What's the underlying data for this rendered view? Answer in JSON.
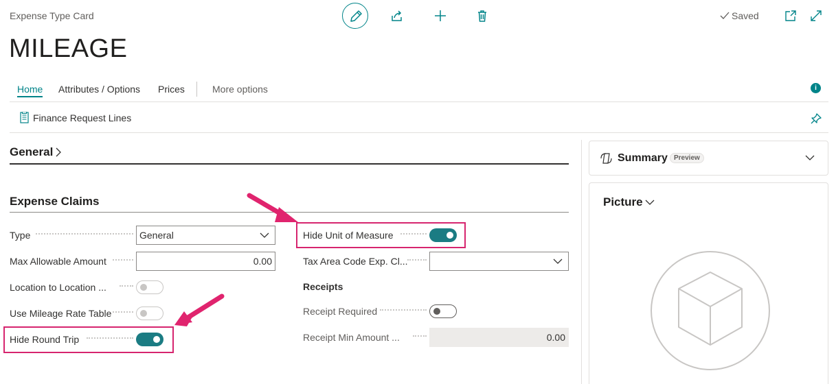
{
  "header": {
    "breadcrumb": "Expense Type Card",
    "title": "MILEAGE",
    "saved_status": "Saved"
  },
  "tabs": [
    {
      "label": "Home",
      "active": true
    },
    {
      "label": "Attributes / Options"
    },
    {
      "label": "Prices"
    },
    {
      "label": "More options"
    }
  ],
  "actions": {
    "finance_request_lines": "Finance Request Lines"
  },
  "sections": {
    "general": "General",
    "expense_claims": "Expense Claims",
    "receipts": "Receipts"
  },
  "fields": {
    "type": {
      "label": "Type",
      "value": "General"
    },
    "max_allowable_amount": {
      "label": "Max Allowable Amount",
      "value": "0.00"
    },
    "location_to_location": {
      "label": "Location to Location ..."
    },
    "use_mileage_rate_table": {
      "label": "Use Mileage Rate Table"
    },
    "hide_round_trip": {
      "label": "Hide Round Trip"
    },
    "hide_unit_of_measure": {
      "label": "Hide Unit of Measure"
    },
    "tax_area_code": {
      "label": "Tax Area Code Exp. Cl...",
      "value": ""
    },
    "receipt_required": {
      "label": "Receipt Required"
    },
    "receipt_min_amount": {
      "label": "Receipt Min Amount ...",
      "value": "0.00"
    }
  },
  "factbox": {
    "summary": "Summary",
    "preview_badge": "Preview",
    "picture": "Picture"
  },
  "colors": {
    "accent": "#008489",
    "toggle_on": "#1b7c83",
    "highlight": "#d6246e"
  }
}
